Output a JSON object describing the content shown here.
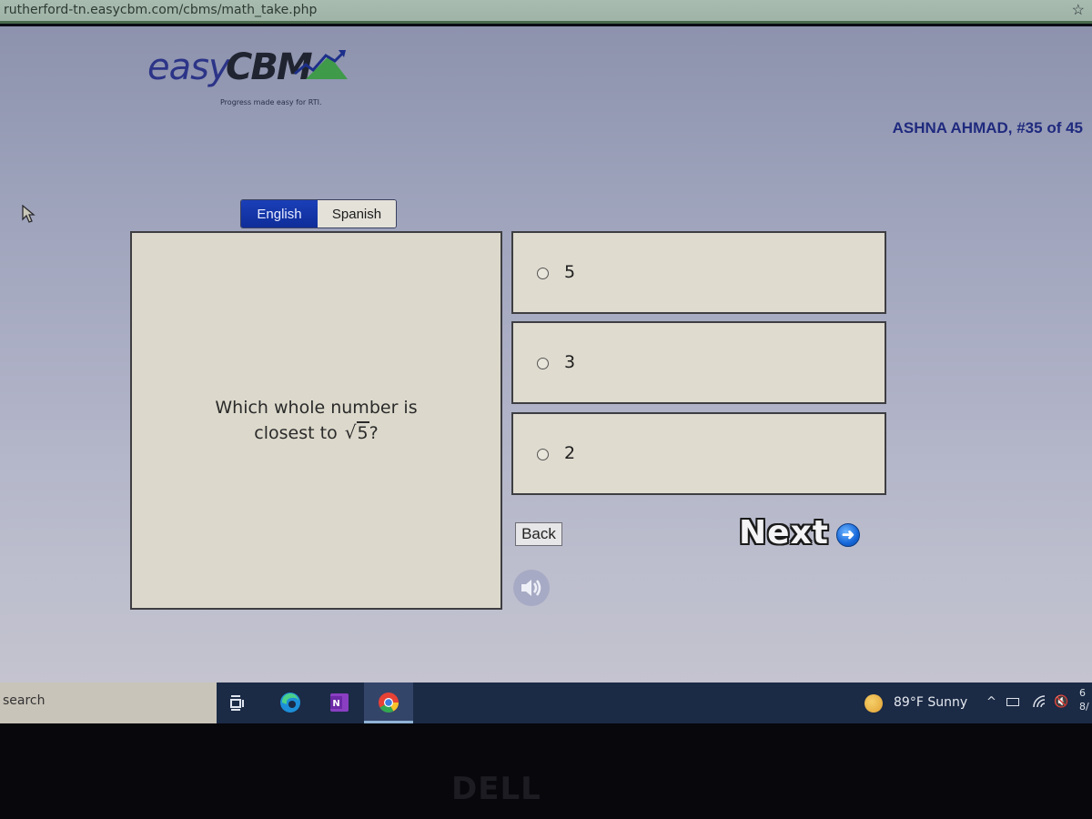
{
  "browser": {
    "url": "rutherford-tn.easycbm.com/cbms/math_take.php",
    "bookmark_icon": "star-icon"
  },
  "header": {
    "logo_easy": "easy",
    "logo_cbm": "CBM",
    "tagline": "Progress made easy for RTI.",
    "student_info": "ASHNA AHMAD, #35 of 45"
  },
  "language": {
    "options": [
      {
        "label": "English",
        "selected": true
      },
      {
        "label": "Spanish",
        "selected": false
      }
    ]
  },
  "question": {
    "text_line1": "Which whole number is",
    "text_line2_prefix": "closest to ",
    "radical_symbol": "√",
    "radicand": "5",
    "text_suffix": "?"
  },
  "choices": [
    {
      "label": "5",
      "selected": false
    },
    {
      "label": "3",
      "selected": false
    },
    {
      "label": "2",
      "selected": false
    }
  ],
  "navigation": {
    "back_label": "Back",
    "next_label": "Next",
    "next_icon": "arrow-right-circle-icon",
    "audio_icon": "speaker-icon"
  },
  "taskbar": {
    "search_label": "search",
    "apps": [
      "task-view",
      "edge",
      "onenote",
      "chrome"
    ],
    "weather": "89°F  Sunny",
    "tray_chevron": "^",
    "tray_volume": "🔇",
    "clock_time": "6",
    "clock_date": "8/"
  },
  "bezel": {
    "brand": "DELL"
  },
  "colors": {
    "accent_blue": "#1a3fb8",
    "student_info": "#1f2a7e",
    "panel_bg": "#dcd9cc",
    "taskbar": "#1b2a45"
  }
}
